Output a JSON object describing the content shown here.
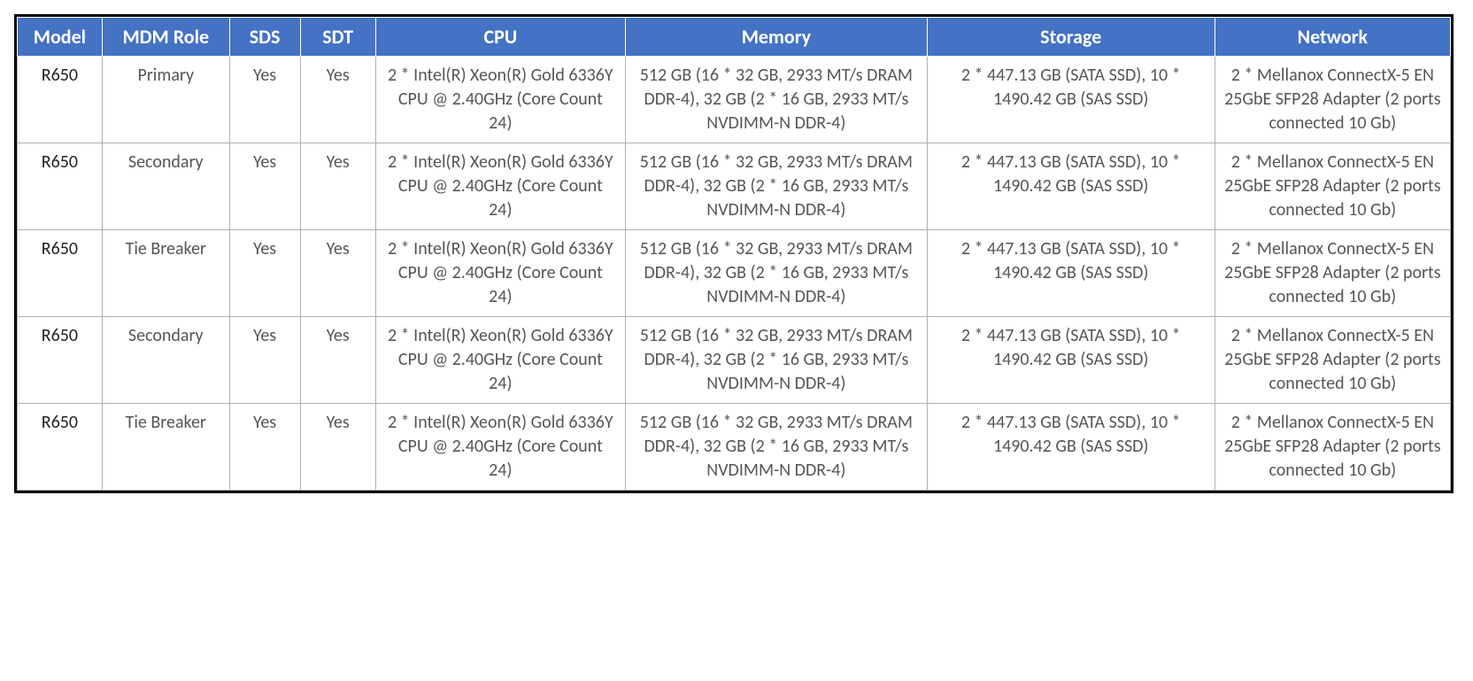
{
  "table": {
    "headers": {
      "model": "Model",
      "role": "MDM Role",
      "sds": "SDS",
      "sdt": "SDT",
      "cpu": "CPU",
      "memory": "Memory",
      "storage": "Storage",
      "network": "Network"
    },
    "rows": [
      {
        "model": "R650",
        "role": "Primary",
        "sds": "Yes",
        "sdt": "Yes",
        "cpu": "2 * Intel(R) Xeon(R) Gold 6336Y CPU @ 2.40GHz (Core Count 24)",
        "memory": "512 GB (16 * 32 GB, 2933 MT/s DRAM DDR-4), 32 GB (2 * 16 GB, 2933 MT/s NVDIMM-N DDR-4)",
        "storage": "2 * 447.13 GB (SATA SSD), 10 * 1490.42 GB (SAS SSD)",
        "network": "2 * Mellanox ConnectX-5 EN 25GbE SFP28 Adapter (2 ports connected 10 Gb)"
      },
      {
        "model": "R650",
        "role": "Secondary",
        "sds": "Yes",
        "sdt": "Yes",
        "cpu": "2 * Intel(R) Xeon(R) Gold 6336Y CPU @ 2.40GHz (Core Count 24)",
        "memory": "512 GB (16 * 32 GB, 2933 MT/s DRAM DDR-4), 32 GB (2 * 16 GB, 2933 MT/s NVDIMM-N DDR-4)",
        "storage": "2 * 447.13 GB (SATA SSD), 10 * 1490.42 GB (SAS SSD)",
        "network": "2 * Mellanox ConnectX-5 EN 25GbE SFP28 Adapter (2 ports connected 10 Gb)"
      },
      {
        "model": "R650",
        "role": "Tie Breaker",
        "sds": "Yes",
        "sdt": "Yes",
        "cpu": "2 * Intel(R) Xeon(R) Gold 6336Y CPU @ 2.40GHz (Core Count 24)",
        "memory": "512 GB (16 * 32 GB, 2933 MT/s DRAM DDR-4), 32 GB (2 * 16 GB, 2933 MT/s NVDIMM-N DDR-4)",
        "storage": "2 * 447.13 GB (SATA SSD), 10 * 1490.42 GB (SAS SSD)",
        "network": "2 * Mellanox ConnectX-5 EN 25GbE SFP28 Adapter (2 ports connected 10 Gb)"
      },
      {
        "model": "R650",
        "role": "Secondary",
        "sds": "Yes",
        "sdt": "Yes",
        "cpu": "2 * Intel(R) Xeon(R) Gold 6336Y CPU @ 2.40GHz (Core Count 24)",
        "memory": "512 GB (16 * 32 GB, 2933 MT/s DRAM DDR-4), 32 GB (2 * 16 GB, 2933 MT/s NVDIMM-N DDR-4)",
        "storage": "2 * 447.13 GB (SATA SSD), 10 * 1490.42 GB (SAS SSD)",
        "network": "2 * Mellanox ConnectX-5 EN 25GbE SFP28 Adapter (2 ports connected 10 Gb)"
      },
      {
        "model": "R650",
        "role": "Tie Breaker",
        "sds": "Yes",
        "sdt": "Yes",
        "cpu": "2 * Intel(R) Xeon(R) Gold 6336Y CPU @ 2.40GHz (Core Count 24)",
        "memory": "512 GB (16 * 32 GB, 2933 MT/s DRAM DDR-4), 32 GB (2 * 16 GB, 2933 MT/s NVDIMM-N DDR-4)",
        "storage": "2 * 447.13 GB (SATA SSD), 10 * 1490.42 GB (SAS SSD)",
        "network": "2 * Mellanox ConnectX-5 EN 25GbE SFP28 Adapter (2 ports connected 10 Gb)"
      }
    ]
  }
}
